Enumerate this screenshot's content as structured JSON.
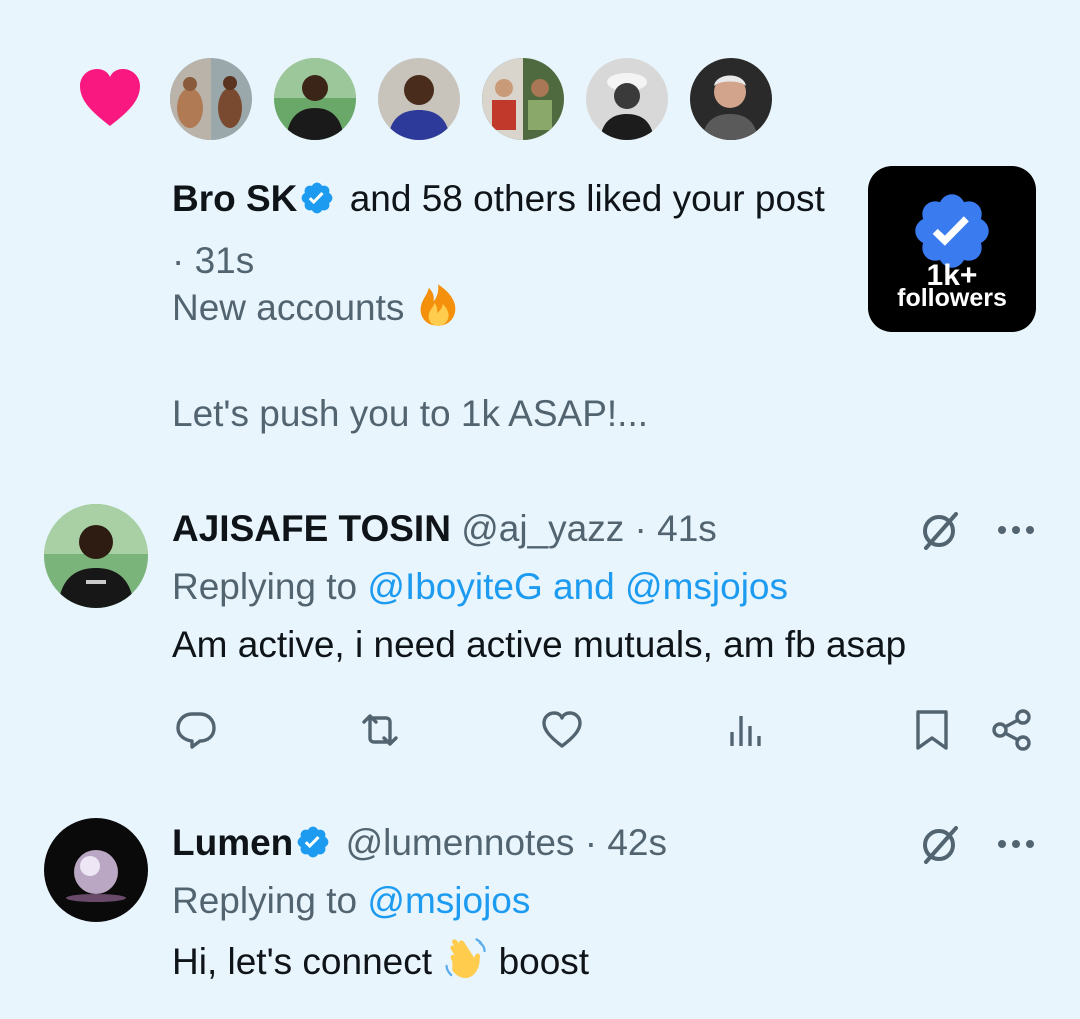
{
  "notification": {
    "liker_name": "Bro SK",
    "liked_text": "and 58 others liked your post",
    "time": "31s",
    "post_preview_line1": "New accounts",
    "post_preview_line2": "Let's push you to 1k ASAP!...",
    "badge_line1": "1k+",
    "badge_line2": "followers",
    "heart_color": "#f91880",
    "verified_color": "#1d9bf0"
  },
  "replies": [
    {
      "name": "AJISAFE TOSIN",
      "handle": "@aj_yazz",
      "time": "41s",
      "replying_label": "Replying to",
      "replying_to": "@IboyiteG and @msjojos",
      "text": "Am active, i need active mutuals, am fb asap"
    },
    {
      "name": "Lumen",
      "handle": "@lumennotes",
      "time": "42s",
      "replying_label": "Replying to",
      "replying_to": "@msjojos",
      "text_before": "Hi, let's connect",
      "text_after": "boost"
    }
  ],
  "actions": {
    "icons": [
      "reply-icon",
      "retweet-icon",
      "like-icon",
      "views-icon",
      "bookmark-icon",
      "share-icon"
    ]
  },
  "colors": {
    "background": "#e8f5fd",
    "muted_text": "#536471",
    "link": "#1d9bf0"
  }
}
